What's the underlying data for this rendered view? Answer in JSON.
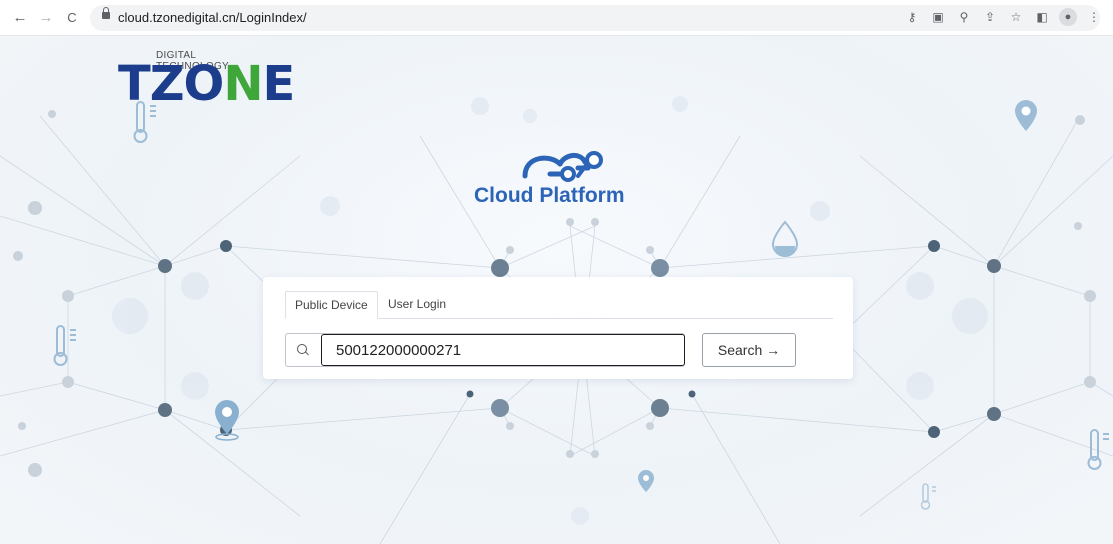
{
  "browser": {
    "url": "cloud.tzonedigital.cn/LoginIndex/",
    "back_icon": "←",
    "forward_icon": "→",
    "reload_icon": "C",
    "toolbar_icons": [
      "key-icon",
      "translate-icon",
      "zoom-icon",
      "share-icon",
      "star-icon",
      "sidebar-icon",
      "profile-icon",
      "menu-icon"
    ]
  },
  "brand": {
    "subtitle": "DIGITAL TECHNOLOGY",
    "name_prefix": "TZO",
    "name_highlight": "N",
    "name_suffix": "E"
  },
  "cloud_logo": {
    "text": "Cloud Platform"
  },
  "login_panel": {
    "tabs": [
      {
        "label": "Public Device",
        "active": true
      },
      {
        "label": "User Login",
        "active": false
      }
    ],
    "search_value": "500122000000271",
    "search_button": "Search →"
  },
  "colors": {
    "brand_blue": "#1b3d8c",
    "brand_green": "#3fa63a",
    "cloud_blue": "#2c64b8"
  }
}
